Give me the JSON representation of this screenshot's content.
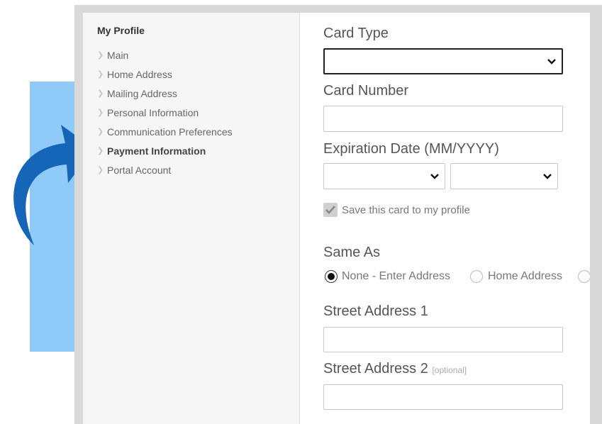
{
  "sidebar": {
    "title": "My Profile",
    "items": [
      {
        "label": "Main",
        "active": false
      },
      {
        "label": "Home Address",
        "active": false
      },
      {
        "label": "Mailing Address",
        "active": false
      },
      {
        "label": "Personal Information",
        "active": false
      },
      {
        "label": "Communication Preferences",
        "active": false
      },
      {
        "label": "Payment Information",
        "active": true
      },
      {
        "label": "Portal Account",
        "active": false
      }
    ]
  },
  "form": {
    "card_type_label": "Card Type",
    "card_type_value": "",
    "card_number_label": "Card Number",
    "card_number_value": "",
    "expiration_label": "Expiration Date (MM/YYYY)",
    "expiration_month_value": "",
    "expiration_year_value": "",
    "save_card_label": "Save this card to my profile",
    "save_card_checked": true,
    "same_as_label": "Same As",
    "same_as_options": [
      {
        "label": "None - Enter Address",
        "selected": true
      },
      {
        "label": "Home Address",
        "selected": false
      },
      {
        "label": "",
        "selected": false
      }
    ],
    "street1_label": "Street Address 1",
    "street1_value": "",
    "street2_label": "Street Address 2",
    "street2_optional": "[optional]",
    "street2_value": ""
  },
  "colors": {
    "accent_panel": "#90caf9",
    "arrow": "#1565b8"
  }
}
